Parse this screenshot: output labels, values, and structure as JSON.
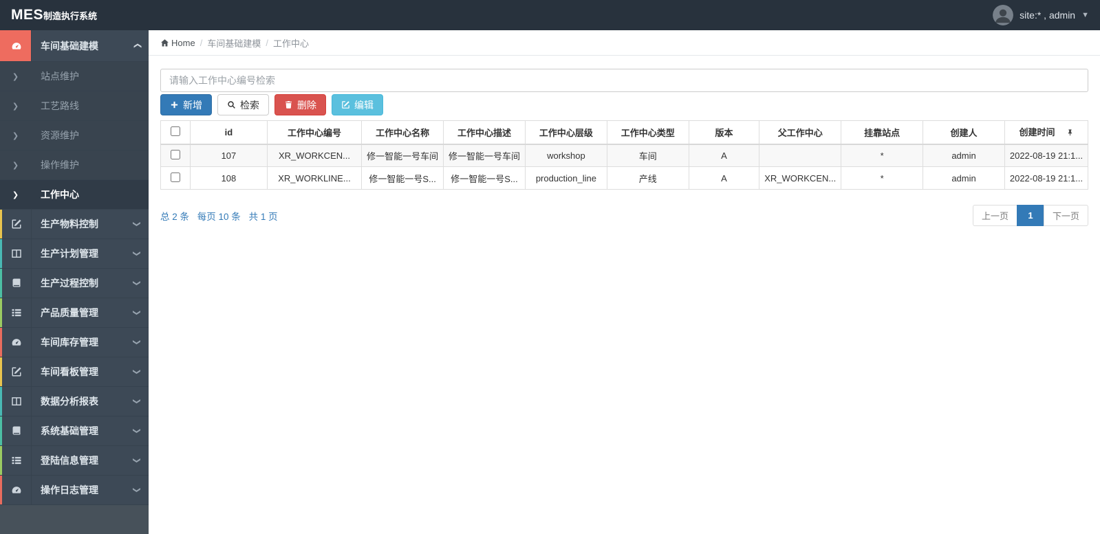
{
  "app": {
    "brand_bold": "MES",
    "brand_rest": "制造执行系统",
    "user_label": "site:* , admin"
  },
  "colors": {
    "navbar": "#28323d",
    "salmon": "#ee6c5f",
    "primary": "#337ab7",
    "danger": "#d9534f",
    "info": "#5bc0de"
  },
  "sidebar": {
    "items": [
      {
        "type": "group",
        "label": "车间基础建模",
        "icon": "dashboard-icon",
        "active": true,
        "expanded": true
      },
      {
        "type": "sub",
        "label": "站点维护"
      },
      {
        "type": "sub",
        "label": "工艺路线"
      },
      {
        "type": "sub",
        "label": "资源维护"
      },
      {
        "type": "sub",
        "label": "操作维护"
      },
      {
        "type": "sub",
        "label": "工作中心",
        "active": true
      },
      {
        "type": "group",
        "label": "生产物料控制",
        "icon": "edit-icon",
        "strip": "#e9c44e"
      },
      {
        "type": "group",
        "label": "生产计划管理",
        "icon": "columns-icon",
        "strip": "#49b9b4"
      },
      {
        "type": "group",
        "label": "生产过程控制",
        "icon": "book-icon",
        "strip": "#4cbfa4"
      },
      {
        "type": "group",
        "label": "产品质量管理",
        "icon": "list-icon",
        "strip": "#9bcb62"
      },
      {
        "type": "group",
        "label": "车间库存管理",
        "icon": "dashboard-icon",
        "strip": "#e96c5e"
      },
      {
        "type": "group",
        "label": "车间看板管理",
        "icon": "edit-icon",
        "strip": "#e9c44e"
      },
      {
        "type": "group",
        "label": "数据分析报表",
        "icon": "columns-icon",
        "strip": "#49b9b4"
      },
      {
        "type": "group",
        "label": "系统基础管理",
        "icon": "book-icon",
        "strip": "#4cbfa4"
      },
      {
        "type": "group",
        "label": "登陆信息管理",
        "icon": "list-icon",
        "strip": "#9bcb62"
      },
      {
        "type": "group",
        "label": "操作日志管理",
        "icon": "dashboard-icon",
        "strip": "#e96c5e"
      }
    ]
  },
  "breadcrumb": {
    "items": [
      "Home",
      "车间基础建模",
      "工作中心"
    ]
  },
  "toolbar": {
    "search_placeholder": "请输入工作中心编号检索",
    "add_label": "新增",
    "search_label": "检索",
    "delete_label": "删除",
    "edit_label": "编辑"
  },
  "table": {
    "columns": [
      "id",
      "工作中心编号",
      "工作中心名称",
      "工作中心描述",
      "工作中心层级",
      "工作中心类型",
      "版本",
      "父工作中心",
      "挂靠站点",
      "创建人",
      "创建时间"
    ],
    "rows": [
      [
        "107",
        "XR_WORKCEN...",
        "修一智能一号车间",
        "修一智能一号车间",
        "workshop",
        "车间",
        "A",
        "",
        "*",
        "admin",
        "2022-08-19 21:1..."
      ],
      [
        "108",
        "XR_WORKLINE...",
        "修一智能一号S...",
        "修一智能一号S...",
        "production_line",
        "产线",
        "A",
        "XR_WORKCEN...",
        "*",
        "admin",
        "2022-08-19 21:1..."
      ]
    ]
  },
  "pagination": {
    "total": "总 2 条",
    "per_page": "每页 10 条",
    "pages": "共 1 页",
    "prev_label": "上一页",
    "current_page": "1",
    "next_label": "下一页"
  }
}
